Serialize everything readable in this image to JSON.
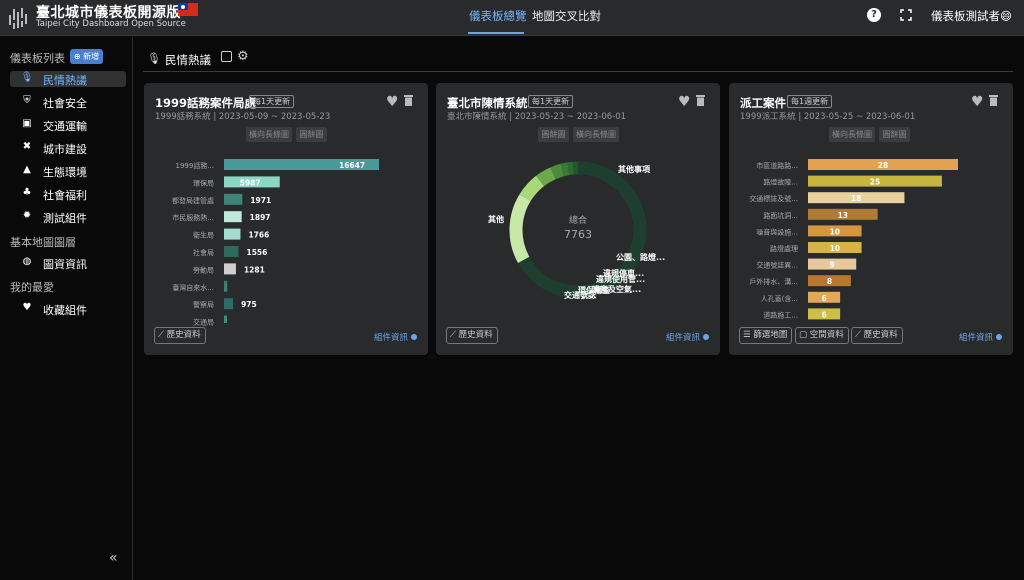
{
  "header": {
    "title": "臺北城市儀表板開源版",
    "subtitle": "Taipei City Dashboard Open Source",
    "tabs": [
      "儀表板總覽",
      "地圖交叉比對"
    ],
    "user": "儀表板測試者😄"
  },
  "sidebar": {
    "list_header": "儀表板列表",
    "new_button": "⊕ 新增",
    "dash_items": [
      {
        "label": "民情熱議",
        "icon": "microphone-icon",
        "active": true
      },
      {
        "label": "社會安全",
        "icon": "shield-icon"
      },
      {
        "label": "交通運輸",
        "icon": "bus-icon"
      },
      {
        "label": "城市建設",
        "icon": "tools-icon"
      },
      {
        "label": "生態環境",
        "icon": "tree-icon"
      },
      {
        "label": "社會福利",
        "icon": "handshake-icon"
      },
      {
        "label": "測試組件",
        "icon": "badge-icon"
      }
    ],
    "map_header": "基本地圖圖層",
    "map_items": [
      {
        "label": "圖資資訊",
        "icon": "globe-icon"
      }
    ],
    "fav_header": "我的最愛",
    "fav_items": [
      {
        "label": "收藏組件",
        "icon": "heart-icon"
      }
    ]
  },
  "toolbar": {
    "title": "民情熱議"
  },
  "cards": [
    {
      "title": "1999話務案件局處",
      "badge": "每1天更新",
      "sub": "1999話務系統 | 2023-05-09 ~ 2023-05-23",
      "chips": [
        "橫向長條圖",
        "圓餅圖"
      ],
      "footer_buttons": [
        "歷史資料"
      ],
      "footer_link": "組件資訊"
    },
    {
      "title": "臺北市陳情系統",
      "badge": "每1天更新",
      "sub": "臺北市陳情系統 | 2023-05-23 ~ 2023-06-01",
      "chips": [
        "圓餅圖",
        "橫向長條圖"
      ],
      "footer_buttons": [
        "歷史資料"
      ],
      "footer_link": "組件資訊"
    },
    {
      "title": "派工案件",
      "badge": "每1週更新",
      "sub": "1999派工系統 | 2023-05-25 ~ 2023-06-01",
      "chips": [
        "橫向長條圖",
        "圓餅圖"
      ],
      "footer_buttons": [
        "篩選地圖",
        "空間資料",
        "歷史資料"
      ],
      "footer_link": "組件資訊"
    }
  ],
  "chart_data": [
    {
      "type": "bar",
      "orientation": "horizontal",
      "categories": [
        "1999話務...",
        "環保局",
        "都發局建管處",
        "市民服務熱...",
        "衛生局",
        "社會局",
        "勞動局",
        "臺灣自來水...",
        "警察局",
        "交通局",
        ""
      ],
      "values": [
        16647,
        5987,
        1971,
        1897,
        1766,
        1556,
        1281,
        350,
        975,
        200,
        80
      ],
      "labels": [
        "16647",
        "5987",
        "1971",
        "1897",
        "1766",
        "1556",
        "1281",
        "",
        "975",
        "",
        ""
      ],
      "colors": [
        "#4a9a9a",
        "#8cd6c4",
        "#3e8577",
        "#c2e8dc",
        "#a6dccf",
        "#2f6b5d",
        "#cfcfcf",
        "#3d7f74",
        "#2e6a66",
        "#3c8c7c",
        "#3b7f7a"
      ]
    },
    {
      "type": "pie",
      "center_label": "總合",
      "total": "7763",
      "slices": [
        {
          "name": "其他",
          "value": 5200,
          "color": "#1e3f30"
        },
        {
          "name": "其他事項",
          "value": 1300,
          "color": "#c8e8a8"
        },
        {
          "name": "公園、路燈...",
          "value": 450,
          "color": "#a8d878"
        },
        {
          "name": "違規停車...",
          "value": 300,
          "color": "#6ea84c"
        },
        {
          "name": "違規使用管...",
          "value": 200,
          "color": "#4c8a3c"
        },
        {
          "name": "噪音及空氣...",
          "value": 120,
          "color": "#3a7a38"
        },
        {
          "name": "環保稽查",
          "value": 100,
          "color": "#2d6a30"
        },
        {
          "name": "交通號誌",
          "value": 93,
          "color": "#1f5a2a"
        }
      ]
    },
    {
      "type": "bar",
      "orientation": "horizontal",
      "categories": [
        "市區道路路...",
        "路燈故障...",
        "交通標誌及號...",
        "路面坑洞...",
        "噪音與設施...",
        "路燈處理",
        "交通號誌異...",
        "戶外排水、溝...",
        "人孔蓋(含...",
        "道路施工...",
        "公共設施...",
        ""
      ],
      "values": [
        28,
        25,
        18,
        13,
        10,
        10,
        9,
        8,
        6,
        6,
        3,
        2
      ],
      "labels": [
        "28",
        "25",
        "18",
        "13",
        "10",
        "10",
        "9",
        "8",
        "6",
        "6",
        "",
        ""
      ],
      "colors": [
        "#e3a24f",
        "#c6b63d",
        "#e9d19c",
        "#b07b35",
        "#d6963e",
        "#d7b34a",
        "#e6c89c",
        "#b8762e",
        "#e0a858",
        "#cdbf46",
        "#d8b06a",
        "#d1c08b"
      ]
    }
  ]
}
